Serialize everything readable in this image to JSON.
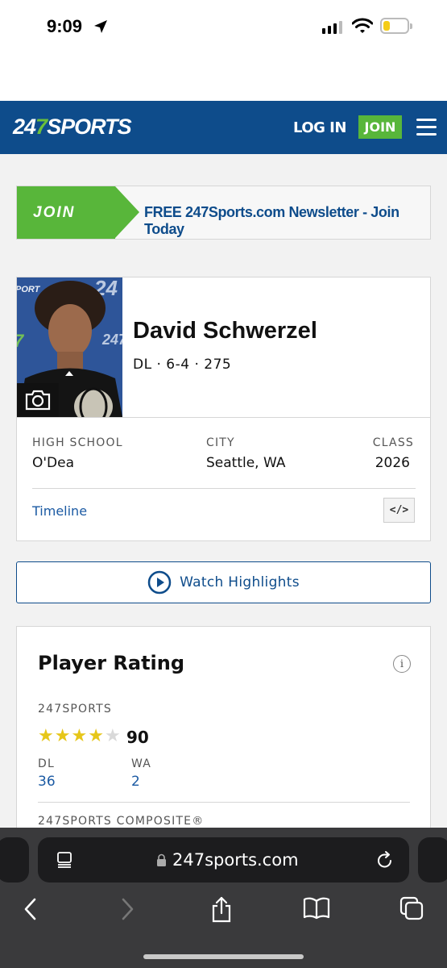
{
  "status_bar": {
    "time": "9:09"
  },
  "header": {
    "logo_prefix": "24",
    "logo_seven": "7",
    "logo_suffix": "SPORTS",
    "login_label": "LOG IN",
    "join_label": "JOIN"
  },
  "newsletter": {
    "join_label": "JOIN",
    "text": "FREE 247Sports.com Newsletter - Join Today"
  },
  "player": {
    "name": "David Schwerzel",
    "position_line": "DL · 6-4 · 275",
    "high_school_label": "HIGH SCHOOL",
    "high_school": "O'Dea",
    "city_label": "CITY",
    "city": "Seattle, WA",
    "class_label": "CLASS",
    "class": "2026",
    "timeline_label": "Timeline",
    "embed_label": "</>"
  },
  "watch": {
    "label": "Watch Highlights"
  },
  "rating": {
    "title": "Player Rating",
    "info_label": "i",
    "source_label": "247SPORTS",
    "stars_filled": 4,
    "stars_total": 5,
    "score": "90",
    "pos_label": "DL",
    "pos_rank": "36",
    "state_label": "WA",
    "state_rank": "2",
    "composite_label": "247SPORTS COMPOSITE®"
  },
  "browser": {
    "url": "247sports.com"
  }
}
